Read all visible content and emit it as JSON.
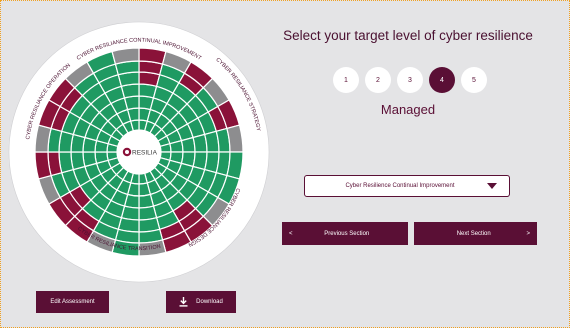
{
  "heading": "Select your target level of cyber resilience",
  "levels": [
    "1",
    "2",
    "3",
    "4",
    "5"
  ],
  "selected_level": "4",
  "selected_level_name": "Managed",
  "section_select": {
    "value": "Cyber Resilience Continual Improvement"
  },
  "nav": {
    "prev_arrow": "<",
    "prev_label": "Previous Section",
    "next_label": "Next Section",
    "next_arrow": ">"
  },
  "actions": {
    "edit_label": "Edit Assessment",
    "download_label": "Download",
    "download_icon": "download-icon"
  },
  "wheel": {
    "logo_text": "RESILIA",
    "sections": [
      "CYBER RESILIANCE CONTINUAL IMPROVEMENT",
      "CYBER RESILIANCE STRATEGY",
      "CYBER RESILIANCE DESIGN",
      "CYBER RESILIANCE TRANSITION",
      "CYBER RESILIANCE OPERATION"
    ],
    "colors": {
      "green": "#1f9a62",
      "red": "#8a1239",
      "grey": "#8d8d8f"
    }
  }
}
